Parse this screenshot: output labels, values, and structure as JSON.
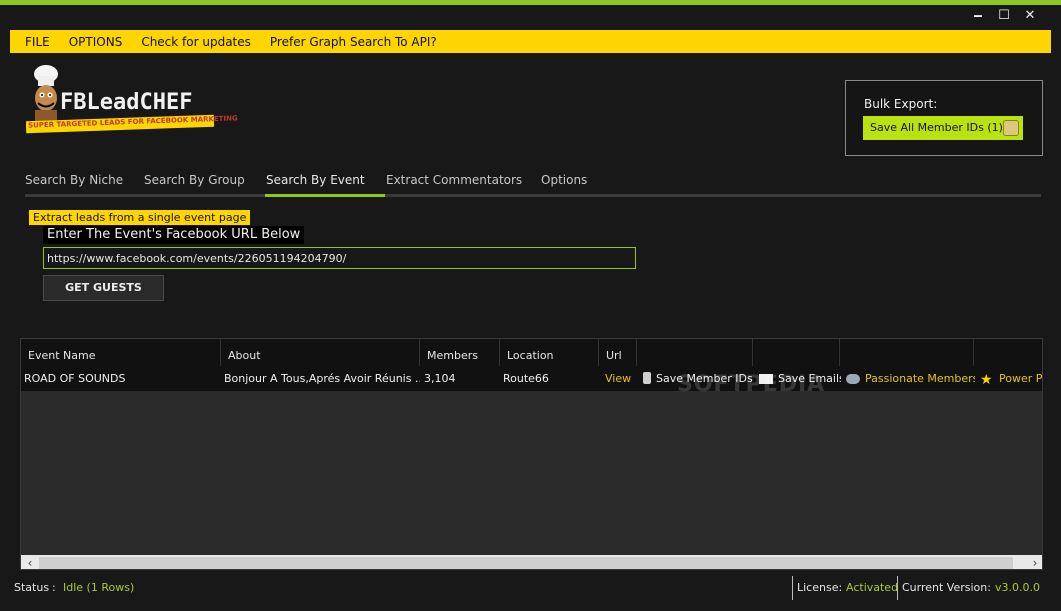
{
  "window": {
    "minimize_glyph": "🗕",
    "maximize_glyph": "☐",
    "close_glyph": "✕"
  },
  "menu": [
    "FILE",
    "OPTIONS",
    "Check for updates",
    "Prefer Graph Search To API?"
  ],
  "logo": {
    "title": "FBLeadCHEF",
    "tagline": "SUPER TARGETED LEADS FOR FACEBOOK MARKETING",
    "icon": "chef-mascot-icon"
  },
  "bulk_export": {
    "label": "Bulk Export:",
    "button": "Save All Member IDs (1)",
    "icon": "export-icon"
  },
  "tabs": [
    "Search By Niche",
    "Search By Group",
    "Search By Event",
    "Extract Commentators",
    "Options"
  ],
  "active_tab": "Search By Event",
  "section": {
    "badge": "Extract leads from a single event page",
    "url_heading": "Enter The Event's Facebook URL Below",
    "url_value": "https://www.facebook.com/events/226051194204790/",
    "get_button": "GET GUESTS"
  },
  "table": {
    "columns": [
      "Event Name",
      "About",
      "Members",
      "Location",
      "Url",
      "",
      "",
      "",
      ""
    ],
    "rows": [
      {
        "event_name": "ROAD OF SOUNDS",
        "about": "Bonjour A Tous,Aprés Avoir Réunis ...",
        "members": "3,104",
        "location": "Route66",
        "url": "View",
        "save_member_ids": "Save Member IDs",
        "save_emails": "Save Emails",
        "passionate_members": "Passionate Members",
        "power_players": "Power Pla"
      }
    ],
    "watermark": "SOFTPEDIA"
  },
  "status": {
    "label": "Status",
    "sep": ":",
    "value": "Idle (1 Rows)",
    "license_label": "License:",
    "license_value": "Activated",
    "version_label": "Current Version:",
    "version_value": "v3.0.0.0"
  },
  "colors": {
    "accent_green": "#8dc71f",
    "menu_yellow": "#ffd500",
    "link_yellow": "#e3c41c"
  }
}
